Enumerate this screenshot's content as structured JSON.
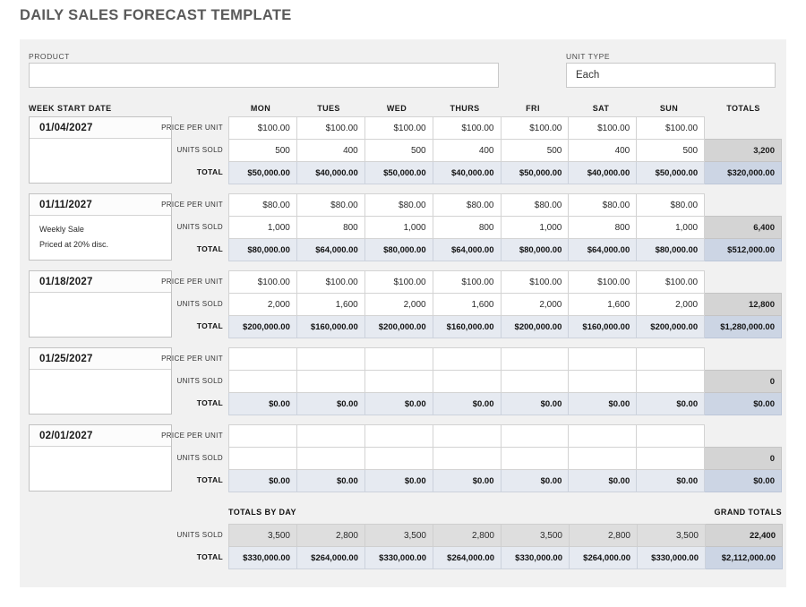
{
  "title": "DAILY SALES FORECAST TEMPLATE",
  "form": {
    "product_label": "PRODUCT",
    "product_value": "",
    "unit_type_label": "UNIT TYPE",
    "unit_type_value": "Each"
  },
  "table": {
    "week_start_header": "WEEK START DATE",
    "day_headers": [
      "MON",
      "TUES",
      "WED",
      "THURS",
      "FRI",
      "SAT",
      "SUN"
    ],
    "totals_header": "TOTALS",
    "row_labels": {
      "price": "PRICE PER UNIT",
      "units": "UNITS SOLD",
      "total": "TOTAL"
    }
  },
  "weeks": [
    {
      "date": "01/04/2027",
      "notes": [],
      "price": [
        "$100.00",
        "$100.00",
        "$100.00",
        "$100.00",
        "$100.00",
        "$100.00",
        "$100.00"
      ],
      "units": [
        "500",
        "400",
        "500",
        "400",
        "500",
        "400",
        "500"
      ],
      "total": [
        "$50,000.00",
        "$40,000.00",
        "$50,000.00",
        "$40,000.00",
        "$50,000.00",
        "$40,000.00",
        "$50,000.00"
      ],
      "units_total": "3,200",
      "grand_total": "$320,000.00"
    },
    {
      "date": "01/11/2027",
      "notes": [
        "Weekly Sale",
        "Priced at 20% disc."
      ],
      "price": [
        "$80.00",
        "$80.00",
        "$80.00",
        "$80.00",
        "$80.00",
        "$80.00",
        "$80.00"
      ],
      "units": [
        "1,000",
        "800",
        "1,000",
        "800",
        "1,000",
        "800",
        "1,000"
      ],
      "total": [
        "$80,000.00",
        "$64,000.00",
        "$80,000.00",
        "$64,000.00",
        "$80,000.00",
        "$64,000.00",
        "$80,000.00"
      ],
      "units_total": "6,400",
      "grand_total": "$512,000.00"
    },
    {
      "date": "01/18/2027",
      "notes": [],
      "price": [
        "$100.00",
        "$100.00",
        "$100.00",
        "$100.00",
        "$100.00",
        "$100.00",
        "$100.00"
      ],
      "units": [
        "2,000",
        "1,600",
        "2,000",
        "1,600",
        "2,000",
        "1,600",
        "2,000"
      ],
      "total": [
        "$200,000.00",
        "$160,000.00",
        "$200,000.00",
        "$160,000.00",
        "$200,000.00",
        "$160,000.00",
        "$200,000.00"
      ],
      "units_total": "12,800",
      "grand_total": "$1,280,000.00"
    },
    {
      "date": "01/25/2027",
      "notes": [],
      "price": [
        "",
        "",
        "",
        "",
        "",
        "",
        ""
      ],
      "units": [
        "",
        "",
        "",
        "",
        "",
        "",
        ""
      ],
      "total": [
        "$0.00",
        "$0.00",
        "$0.00",
        "$0.00",
        "$0.00",
        "$0.00",
        "$0.00"
      ],
      "units_total": "0",
      "grand_total": "$0.00"
    },
    {
      "date": "02/01/2027",
      "notes": [],
      "price": [
        "",
        "",
        "",
        "",
        "",
        "",
        ""
      ],
      "units": [
        "",
        "",
        "",
        "",
        "",
        "",
        ""
      ],
      "total": [
        "$0.00",
        "$0.00",
        "$0.00",
        "$0.00",
        "$0.00",
        "$0.00",
        "$0.00"
      ],
      "units_total": "0",
      "grand_total": "$0.00"
    }
  ],
  "summary": {
    "totals_by_day_label": "TOTALS BY DAY",
    "grand_totals_label": "GRAND TOTALS",
    "units_label": "UNITS SOLD",
    "total_label": "TOTAL",
    "units": [
      "3,500",
      "2,800",
      "3,500",
      "2,800",
      "3,500",
      "2,800",
      "3,500"
    ],
    "units_grand": "22,400",
    "totals": [
      "$330,000.00",
      "$264,000.00",
      "$330,000.00",
      "$264,000.00",
      "$330,000.00",
      "$264,000.00",
      "$330,000.00"
    ],
    "totals_grand": "$2,112,000.00"
  },
  "colors": {
    "panel_bg": "#f1f1f1",
    "total_row_bg": "#e6eaf1",
    "grand_bg": "#ccd5e4",
    "units_total_bg": "#d4d4d4",
    "title": "#5a5a5a"
  }
}
